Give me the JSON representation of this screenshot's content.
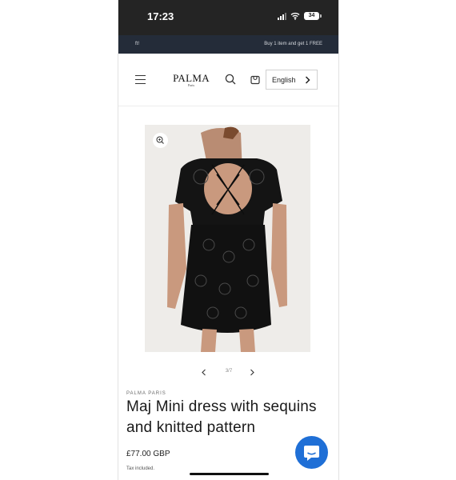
{
  "status_bar": {
    "time": "17:23",
    "battery": "34"
  },
  "announcement": {
    "left_text": "ft!",
    "right_text": "Buy 1 item and get 1 FREE"
  },
  "header": {
    "logo_text": "PALMA",
    "logo_subtext": "Paris",
    "language": "English"
  },
  "gallery": {
    "counter": "3/7"
  },
  "product": {
    "vendor": "PALMA PARIS",
    "title": "Maj Mini dress with sequins and knitted pattern",
    "price": "£77.00 GBP",
    "tax_note": "Tax included."
  },
  "colors": {
    "status_bar_bg": "#242424",
    "announcement_bg": "#242c39",
    "chat_button": "#1f6fd6",
    "image_bg": "#eeece9"
  },
  "icons": [
    "menu-icon",
    "search-icon",
    "cart-icon",
    "chevron-right-icon",
    "zoom-icon",
    "chevron-left-icon",
    "chat-icon"
  ]
}
